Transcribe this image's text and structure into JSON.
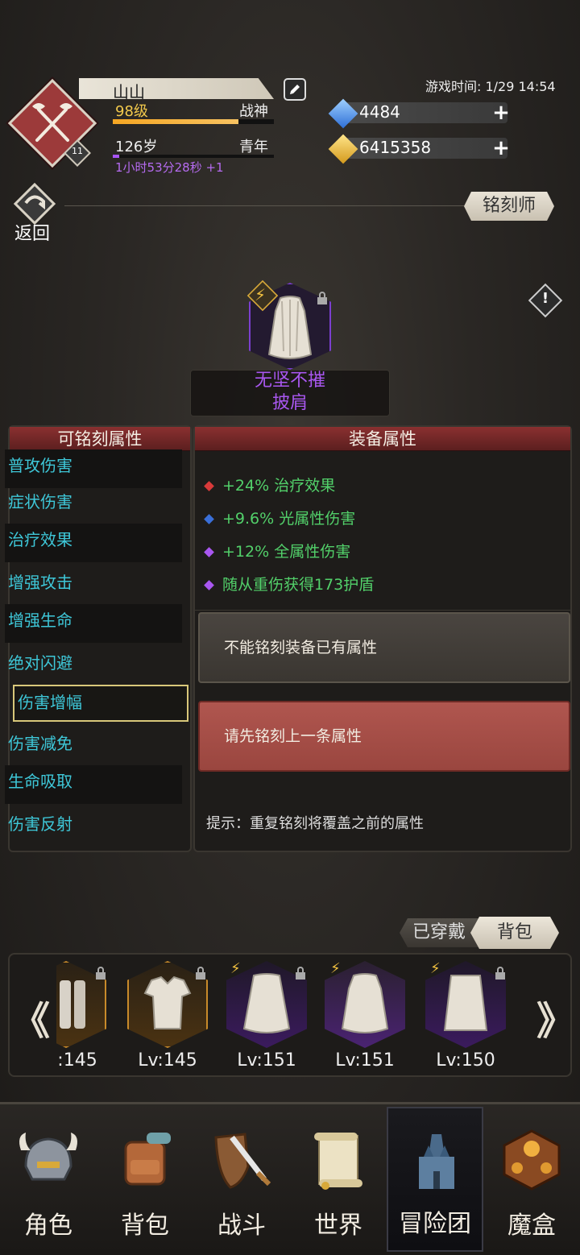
{
  "header": {
    "player_name": "山山",
    "level": "98级",
    "title": "战神",
    "exp_progress": 0.78,
    "age": "126岁",
    "age_stage": "青年",
    "age_progress": 0.04,
    "timer": "1小时53分28秒 +1",
    "avatar_level": "11",
    "game_time": "游戏时间: 1/29 14:54",
    "diamonds": "4484",
    "gold": "6415358"
  },
  "nav": {
    "back_label": "返回",
    "role_tab": "铭刻师"
  },
  "item": {
    "name": "无坚不摧",
    "type": "披肩"
  },
  "left_panel": {
    "title": "可铭刻属性",
    "attributes": [
      "普攻伤害",
      "症状伤害",
      "治疗效果",
      "增强攻击",
      "增强生命",
      "绝对闪避",
      "伤害增幅",
      "伤害减免",
      "生命吸取",
      "伤害反射"
    ],
    "selected_index": 6
  },
  "right_panel": {
    "title": "装备属性",
    "attributes": [
      {
        "text": "+24% 治疗效果",
        "color": "#d83a3a"
      },
      {
        "text": "+9.6% 光属性伤害",
        "color": "#3a6fd8"
      },
      {
        "text": "+12% 全属性伤害",
        "color": "#a957f0"
      },
      {
        "text": "随从重伤获得173护盾",
        "color": "#a957f0"
      }
    ],
    "message_grey": "不能铭刻装备已有属性",
    "message_red": "请先铭刻上一条属性",
    "tip": "提示：重复铭刻将覆盖之前的属性"
  },
  "inventory": {
    "equipped_tab": "已穿戴",
    "bag_tab": "背包",
    "slots": [
      {
        "level": ":145",
        "rarity": "gold",
        "locked": true
      },
      {
        "level": "Lv:145",
        "rarity": "gold",
        "locked": true
      },
      {
        "level": "Lv:151",
        "rarity": "purple",
        "locked": true
      },
      {
        "level": "Lv:151",
        "rarity": "purple",
        "locked": false
      },
      {
        "level": "Lv:150",
        "rarity": "purple",
        "locked": true
      }
    ],
    "prev_arrow": "《",
    "next_arrow": "》"
  },
  "bottom_nav": [
    {
      "label": "角色",
      "icon": "helmet-icon"
    },
    {
      "label": "背包",
      "icon": "backpack-icon"
    },
    {
      "label": "战斗",
      "icon": "sword-shield-icon"
    },
    {
      "label": "世界",
      "icon": "scroll-map-icon"
    },
    {
      "label": "冒险团",
      "icon": "castle-icon"
    },
    {
      "label": "魔盒",
      "icon": "magic-box-icon"
    }
  ],
  "colors": {
    "accent_red": "#8a3030",
    "attr_cyan": "#3ec7d8",
    "attr_green": "#52d06a",
    "epic_purple": "#a957f0"
  }
}
